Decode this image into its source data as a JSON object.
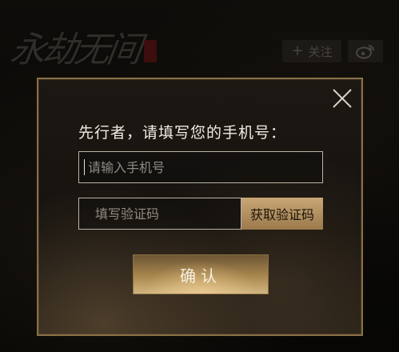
{
  "background": {
    "logo_text": "永劫无间",
    "follow_label": "关注",
    "follow_plus": "+"
  },
  "dialog": {
    "title": "先行者，请填写您的手机号：",
    "phone_placeholder": "请输入手机号",
    "code_placeholder": "填写验证码",
    "get_code_label": "获取验证码",
    "confirm_label": "确认"
  },
  "icons": {
    "close": "close-icon",
    "weibo": "weibo-icon"
  },
  "colors": {
    "accent_gold": "#c8a676",
    "border_gold": "#8a6f45",
    "text_light": "#f2ede4"
  }
}
